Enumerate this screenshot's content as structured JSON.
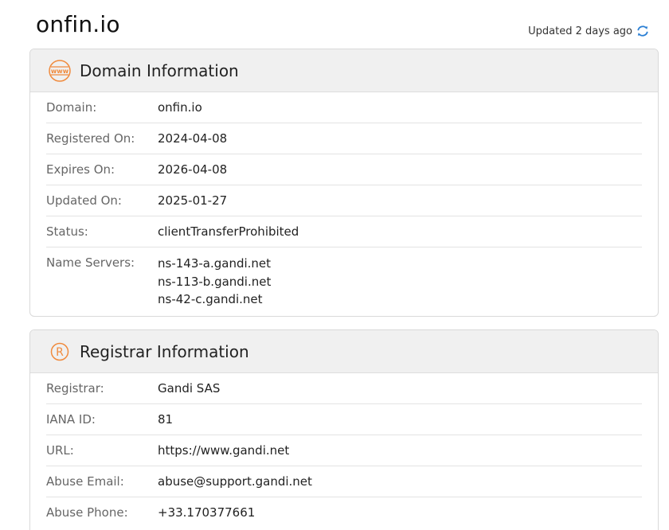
{
  "header": {
    "title": "onfin.io",
    "updated_text": "Updated 2 days ago"
  },
  "domain_info": {
    "title": "Domain Information",
    "icon": "www-icon",
    "rows": [
      {
        "label": "Domain:",
        "value": "onfin.io"
      },
      {
        "label": "Registered On:",
        "value": "2024-04-08"
      },
      {
        "label": "Expires On:",
        "value": "2026-04-08"
      },
      {
        "label": "Updated On:",
        "value": "2025-01-27"
      },
      {
        "label": "Status:",
        "value": "clientTransferProhibited"
      }
    ],
    "name_servers": {
      "label": "Name Servers:",
      "values": [
        "ns-143-a.gandi.net",
        "ns-113-b.gandi.net",
        "ns-42-c.gandi.net"
      ]
    }
  },
  "registrar_info": {
    "title": "Registrar Information",
    "icon": "registered-icon",
    "rows": [
      {
        "label": "Registrar:",
        "value": "Gandi SAS"
      },
      {
        "label": "IANA ID:",
        "value": "81"
      },
      {
        "label": "URL:",
        "value": "https://www.gandi.net"
      },
      {
        "label": "Abuse Email:",
        "value": "abuse@support.gandi.net"
      },
      {
        "label": "Abuse Phone:",
        "value": "+33.170377661"
      }
    ]
  },
  "colors": {
    "accent_orange": "#f08a3c",
    "refresh_blue": "#2a7fd4"
  }
}
